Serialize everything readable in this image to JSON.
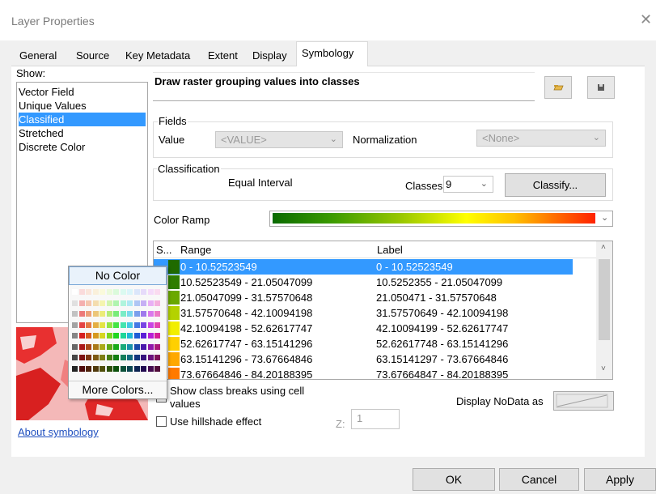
{
  "window": {
    "title": "Layer Properties",
    "close_glyph": "✕"
  },
  "tabs": [
    {
      "label": "General",
      "selected": false
    },
    {
      "label": "Source",
      "selected": false
    },
    {
      "label": "Key Metadata",
      "selected": false
    },
    {
      "label": "Extent",
      "selected": false
    },
    {
      "label": "Display",
      "selected": false
    },
    {
      "label": "Symbology",
      "selected": true
    }
  ],
  "show": {
    "label": "Show:",
    "items": [
      {
        "label": "Vector Field",
        "selected": false
      },
      {
        "label": "Unique Values",
        "selected": false
      },
      {
        "label": "Classified",
        "selected": true
      },
      {
        "label": "Stretched",
        "selected": false
      },
      {
        "label": "Discrete Color",
        "selected": false
      }
    ]
  },
  "header": {
    "text": "Draw raster grouping values into classes",
    "open_icon": "folder-open-icon",
    "save_icon": "save-icon"
  },
  "fields": {
    "group_label": "Fields",
    "value_label": "Value",
    "value_selected": "<VALUE>",
    "normalization_label": "Normalization",
    "normalization_selected": "<None>"
  },
  "classification": {
    "group_label": "Classification",
    "method": "Equal Interval",
    "classes_label": "Classes",
    "classes_value": "9",
    "classify_button": "Classify..."
  },
  "color_ramp": {
    "label": "Color Ramp",
    "colors": [
      "#0a6a00",
      "#3a9a00",
      "#9ac800",
      "#ffff00",
      "#ffc000",
      "#ff6a00",
      "#ff2200"
    ]
  },
  "table": {
    "headers": {
      "symbol": "S...",
      "range": "Range",
      "label": "Label"
    },
    "rows": [
      {
        "color": "#1f6a00",
        "range": "0 - 10.52523549",
        "label": "0 - 10.52523549",
        "selected": true
      },
      {
        "color": "#2e7d00",
        "range": "10.52523549 - 21.05047099",
        "label": "10.5252355 - 21.05047099",
        "selected": false
      },
      {
        "color": "#6aa800",
        "range": "21.05047099 - 31.57570648",
        "label": "21.050471 - 31.57570648",
        "selected": false
      },
      {
        "color": "#b4d200",
        "range": "31.57570648 - 42.10094198",
        "label": "31.57570649 - 42.10094198",
        "selected": false
      },
      {
        "color": "#f2ee00",
        "range": "42.10094198 - 52.62617747",
        "label": "42.10094199 - 52.62617747",
        "selected": false
      },
      {
        "color": "#ffd000",
        "range": "52.62617747 - 63.15141296",
        "label": "52.62617748 - 63.15141296",
        "selected": false
      },
      {
        "color": "#ffa800",
        "range": "63.15141296 - 73.67664846",
        "label": "63.15141297 - 73.67664846",
        "selected": false
      },
      {
        "color": "#ff7a00",
        "range": "73.67664846 - 84.20188395",
        "label": "73.67664847 - 84.20188395",
        "selected": false
      }
    ]
  },
  "color_picker": {
    "no_color": "No Color",
    "more_colors": "More Colors..."
  },
  "options": {
    "show_breaks_line1": "Show class breaks using cell",
    "show_breaks_line2": "values",
    "hillshade": "Use hillshade effect",
    "z_label": "Z:",
    "z_value": "1",
    "nodata_label": "Display NoData as"
  },
  "about_link": "About symbology",
  "buttons": {
    "ok": "OK",
    "cancel": "Cancel",
    "apply": "Apply"
  }
}
